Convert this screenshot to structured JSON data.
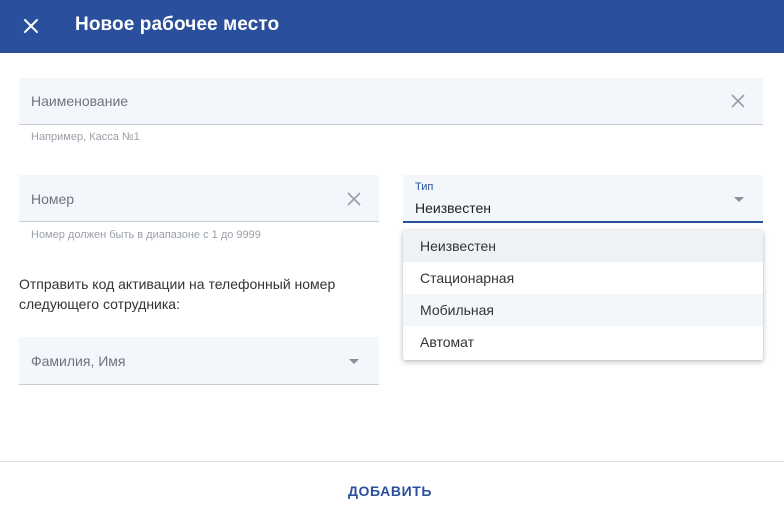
{
  "header": {
    "title": "Новое рабочее место"
  },
  "form": {
    "name": {
      "placeholder": "Наименование",
      "hint": "Например, Касса №1"
    },
    "number": {
      "placeholder": "Номер",
      "hint": "Номер должен быть в диапазоне с 1 до 9999"
    },
    "type": {
      "label": "Тип",
      "value": "Неизвестен",
      "options": [
        "Неизвестен",
        "Стационарная",
        "Мобильная",
        "Автомат"
      ]
    },
    "send_code_text": "Отправить код активации на телефонный номер следующего сотрудника:",
    "employee": {
      "placeholder": "Фамилия, Имя"
    }
  },
  "footer": {
    "add_label": "ДОБАВИТЬ"
  },
  "colors": {
    "primary": "#2a4f9c",
    "field_bg": "#f3f6fb"
  }
}
